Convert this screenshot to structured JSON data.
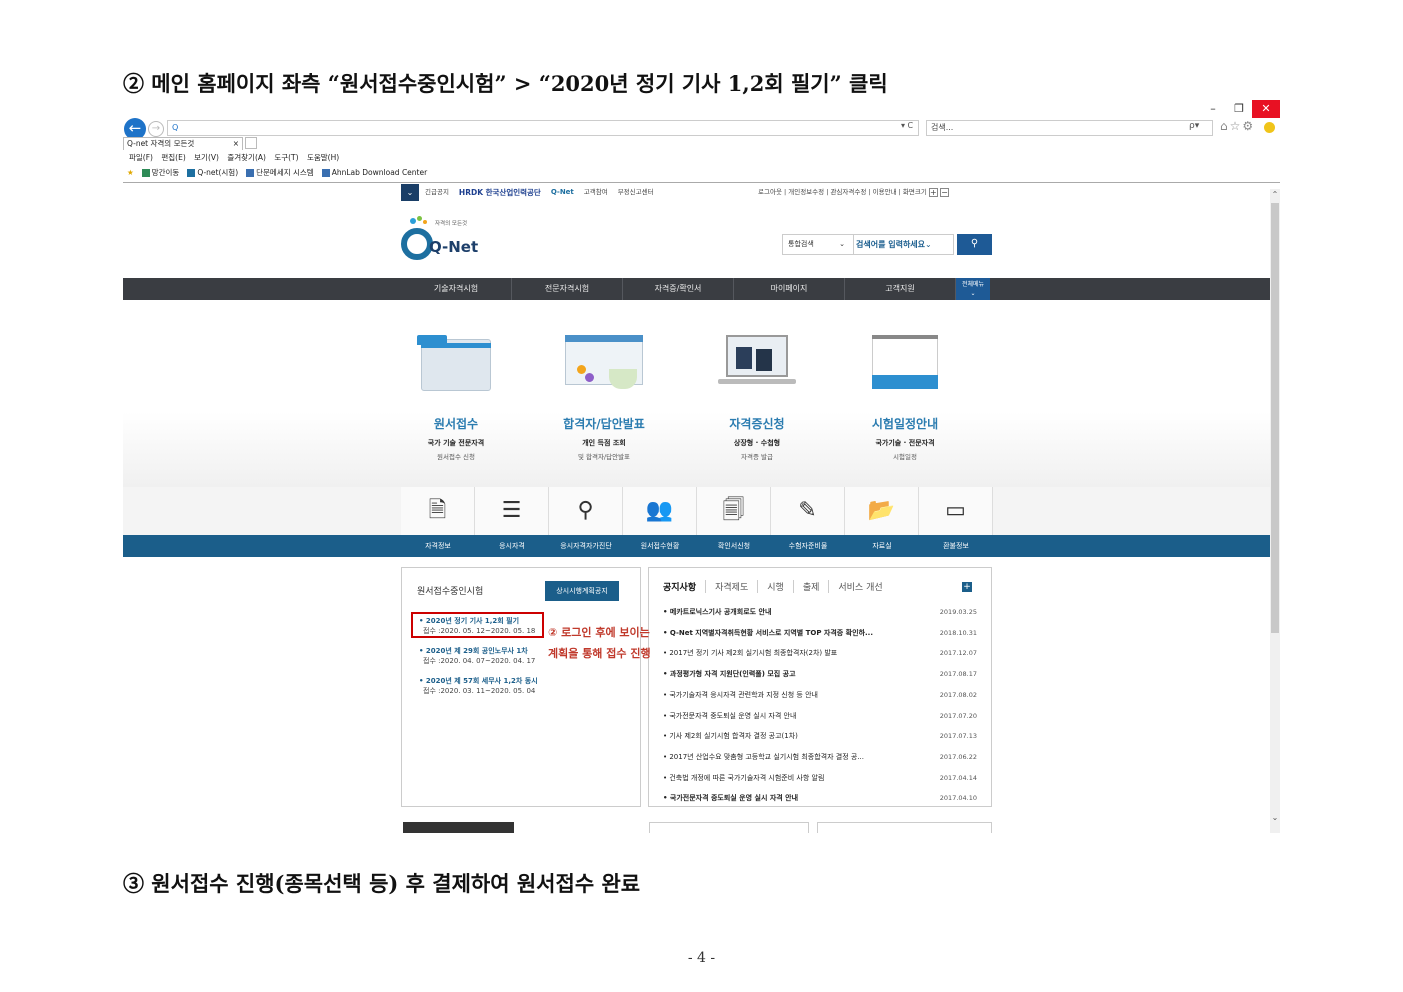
{
  "doc": {
    "step2": "② 메인 홈페이지 좌측 “원서접수중인시험” > “2020년 정기 기사 1,2회 필기” 클릭",
    "step3": "③ 원서접수 진행(종목선택 등) 후 결제하여 원서접수 완료",
    "page_number": "- 4 -"
  },
  "browser": {
    "window_buttons": [
      "–",
      "❐",
      "✕"
    ],
    "url": "Q",
    "url_controls": "▾ C",
    "search_placeholder": "검색...",
    "search_icon": "ρ▾",
    "toolbar_icons": "⌂☆⚙",
    "tab_label": "Q-net 자격의 모든것",
    "tab_close": "×",
    "menu": [
      "파일(F)",
      "편집(E)",
      "보기(V)",
      "즐겨찾기(A)",
      "도구(T)",
      "도움말(H)"
    ],
    "favorites": [
      "★",
      "망간이동",
      "Q-net(시험)",
      "단문메세지 시스템",
      "AhnLab Download Center"
    ]
  },
  "site": {
    "util_left": [
      "긴급공지",
      "HRDK 한국산업인력공단",
      "Q-Net",
      "고객참여",
      "부정신고센터"
    ],
    "util_right": "로그아웃 | 개인정보수정 | 관심자격수정 | 이용안내 | 화면크기",
    "logo_tagline": "자격의 모든것",
    "logo_text": "Q-Net",
    "search_select": "통합검색",
    "search_input": "검색어를 입력하세요",
    "nav": [
      "기술자격시험",
      "전문자격시험",
      "자격증/확인서",
      "마이페이지",
      "고객지원"
    ],
    "nav_all": "전체메뉴",
    "features": [
      {
        "title": "원서접수",
        "sub1": "국가 기술 전문자격",
        "sub2": "원서접수 신청"
      },
      {
        "title": "합격자/답안발표",
        "sub1": "개인 득점 조회",
        "sub2": "및 합격자/답안발표"
      },
      {
        "title": "자격증신청",
        "sub1": "상장형 · 수첩형",
        "sub2": "자격증 발급"
      },
      {
        "title": "시험일정안내",
        "sub1": "국가기술 · 전문자격",
        "sub2": "시험일정"
      }
    ],
    "quick_icons": [
      "🗎",
      "☰",
      "⚲",
      "👥",
      "🗐",
      "✎",
      "📂",
      "▭"
    ],
    "quick_labels": [
      "자격정보",
      "응시자격",
      "응시자격자가진단",
      "원서접수현황",
      "확인서신청",
      "수험자준비물",
      "자료실",
      "환불정보"
    ],
    "exam_panel": {
      "title": "원서접수중인시험",
      "button": "상시시행계획공지",
      "exams": [
        {
          "title": "2020년 정기 기사 1,2회 필기",
          "dates": "접수 :2020. 05. 12~2020. 05. 18"
        },
        {
          "title": "2020년 제 29회 공인노무사 1차",
          "dates": "접수 :2020. 04. 07~2020. 04. 17"
        },
        {
          "title": "2020년 제 57회 세무사 1,2차 동시",
          "dates": "접수 :2020. 03. 11~2020. 05. 04"
        }
      ]
    },
    "annotation": {
      "line1": "② 로그인 후에 보이는",
      "line2": "계획을 통해 접수 진행"
    },
    "notice_panel": {
      "tabs": [
        "공지사항",
        "자격제도",
        "시행",
        "출제",
        "서비스 개선"
      ],
      "plus": "+",
      "items": [
        {
          "title": "메카트로닉스기사 공개회로도 안내",
          "date": "2019.03.25"
        },
        {
          "title": "Q-Net 지역별자격취득현황 서비스로 지역별 TOP 자격증 확인하...",
          "date": "2018.10.31"
        },
        {
          "title": "2017년 정기 기사 제2회 실기시험 최종합격자(2차) 발표",
          "date": "2017.12.07"
        },
        {
          "title": "과정평가형 자격 지원단(인력풀) 모집 공고",
          "date": "2017.08.17"
        },
        {
          "title": "국가기술자격 응시자격 관련학과 지정 신청 등 안내",
          "date": "2017.08.02"
        },
        {
          "title": "국가전문자격 중도퇴실 운영 실시 자격 안내",
          "date": "2017.07.20"
        },
        {
          "title": "기사 제2회 실기시험 합격자 결정 공고(1차)",
          "date": "2017.07.13"
        },
        {
          "title": "2017년 산업수요 맞춤형 고등학교 실기시험 최종합격자 결정 공...",
          "date": "2017.06.22"
        },
        {
          "title": "건축법 개정에 따른 국가기술자격 시험준비 사항 알림",
          "date": "2017.04.14"
        },
        {
          "title": "국가전문자격 중도퇴실 운영 실시 자격 안내",
          "date": "2017.04.10"
        }
      ]
    }
  }
}
